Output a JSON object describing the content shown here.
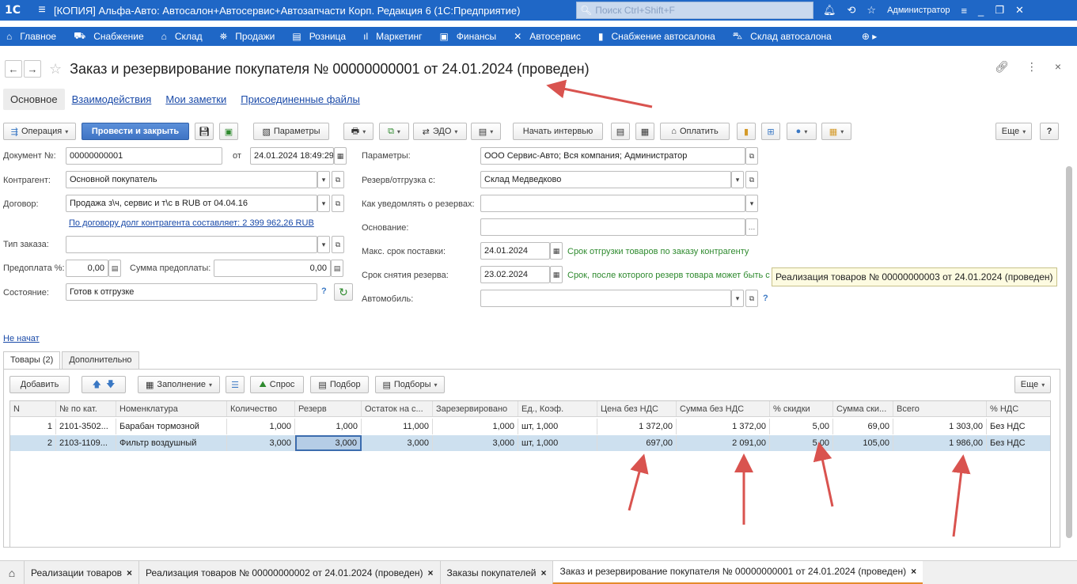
{
  "titlebar": {
    "logo": "1С",
    "title": "[КОПИЯ] Альфа-Авто: Автосалон+Автосервис+Автозапчасти Корп. Редакция 6  (1С:Предприятие)",
    "search_placeholder": "Поиск Ctrl+Shift+F",
    "user": "Администратор"
  },
  "sections": [
    {
      "label": "Главное",
      "icon": "home-icon"
    },
    {
      "label": "Снабжение",
      "icon": "truck-icon"
    },
    {
      "label": "Склад",
      "icon": "warehouse-icon"
    },
    {
      "label": "Продажи",
      "icon": "cart-icon"
    },
    {
      "label": "Розница",
      "icon": "register-icon"
    },
    {
      "label": "Маркетинг",
      "icon": "bars-icon"
    },
    {
      "label": "Финансы",
      "icon": "finance-icon"
    },
    {
      "label": "Автосервис",
      "icon": "tools-icon"
    },
    {
      "label": "Снабжение автосалона",
      "icon": "doc-icon"
    },
    {
      "label": "Склад автосалона",
      "icon": "car-icon"
    }
  ],
  "document": {
    "title": "Заказ и резервирование покупателя № 00000000001 от 24.01.2024 (проведен)"
  },
  "tabs": {
    "main": "Основное",
    "interaction": "Взаимодействия",
    "notes": "Мои заметки",
    "files": "Присоединенные файлы"
  },
  "toolbar": {
    "operation": "Операция",
    "post_close": "Провести и закрыть",
    "params": "Параметры",
    "edo": "ЭДО",
    "interview": "Начать интервью",
    "pay": "Оплатить",
    "more": "Еще",
    "help": "?"
  },
  "form": {
    "doc_no_label": "Документ №:",
    "doc_no": "00000000001",
    "date_label": "от",
    "date": "24.01.2024 18:49:29",
    "contractor_label": "Контрагент:",
    "contractor": "Основной покупатель",
    "contract_label": "Договор:",
    "contract": "Продажа з\\ч, сервис и т\\с в RUB от 04.04.16",
    "debt_link": "По договору долг контрагента составляет: 2 399 962,26 RUB",
    "order_type_label": "Тип заказа:",
    "order_type": "",
    "prepay_pct_label": "Предоплата %:",
    "prepay_pct": "0,00",
    "prepay_sum_label": "Сумма предоплаты:",
    "prepay_sum": "0,00",
    "state_label": "Состояние:",
    "state": "Готов к отгрузке",
    "params_label": "Параметры:",
    "params": "ООО Сервис-Авто; Вся компания; Администратор",
    "reserve_label": "Резерв/отгрузка с:",
    "reserve": "Склад Медведково",
    "notify_label": "Как уведомлять о резервах:",
    "notify": "",
    "basis_label": "Основание:",
    "basis": "",
    "max_delivery_label": "Макс. срок поставки:",
    "max_delivery": "24.01.2024",
    "max_delivery_hint": "Срок отгрузки товаров по заказу контрагенту",
    "reserve_remove_label": "Срок снятия резерва:",
    "reserve_remove": "23.02.2024",
    "reserve_remove_hint": "Срок, после которого резерв товара может быть с",
    "car_label": "Автомобиль:",
    "car": "",
    "not_started": "Не начат",
    "tooltip": "Реализация товаров № 00000000003 от 24.01.2024 (проведен)"
  },
  "subtabs": {
    "goods": "Товары (2)",
    "extra": "Дополнительно"
  },
  "table_toolbar": {
    "add": "Добавить",
    "fill": "Заполнение",
    "demand": "Спрос",
    "pick": "Подбор",
    "picks": "Подборы",
    "more": "Еще"
  },
  "table": {
    "columns": [
      "N",
      "№ по кат.",
      "Номенклатура",
      "Количество",
      "Резерв",
      "Остаток на с...",
      "Зарезервировано",
      "Ед., Коэф.",
      "Цена без НДС",
      "Сумма без НДС",
      "% скидки",
      "Сумма ски...",
      "Всего",
      "% НДС"
    ],
    "rows": [
      [
        "1",
        "2101-3502...",
        "Барабан тормозной",
        "1,000",
        "1,000",
        "11,000",
        "1,000",
        "шт, 1,000",
        "1 372,00",
        "1 372,00",
        "5,00",
        "69,00",
        "1 303,00",
        "Без НДС"
      ],
      [
        "2",
        "2103-1109...",
        "Фильтр воздушный",
        "3,000",
        "3,000",
        "3,000",
        "3,000",
        "шт, 1,000",
        "697,00",
        "2 091,00",
        "5,00",
        "105,00",
        "1 986,00",
        "Без НДС"
      ]
    ]
  },
  "taskbar": [
    {
      "label": "Реализации товаров"
    },
    {
      "label": "Реализация товаров № 00000000002 от 24.01.2024 (проведен)"
    },
    {
      "label": "Заказы покупателей"
    },
    {
      "label": "Заказ и резервирование покупателя № 00000000001 от 24.01.2024 (проведен)"
    }
  ],
  "colors": {
    "accent": "#1f67c6",
    "annotation_arrow": "#d9534f",
    "active_tab_underline": "#e48b2b"
  }
}
